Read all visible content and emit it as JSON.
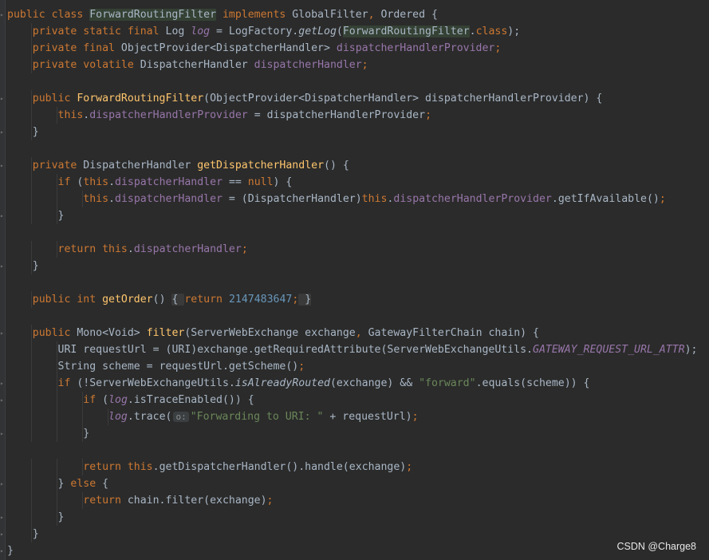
{
  "editor": {
    "lines": [
      [
        [
          "public class ",
          "k"
        ],
        [
          "ForwardRoutingFilter",
          "hl"
        ],
        [
          " implements ",
          "k"
        ],
        [
          "GlobalFilter",
          ""
        ],
        [
          ", ",
          "k"
        ],
        [
          "Ordered {",
          ""
        ]
      ],
      [
        [
          "    ",
          ""
        ],
        [
          "private static final ",
          "k"
        ],
        [
          "Log ",
          ""
        ],
        [
          "log",
          "fi"
        ],
        [
          " = LogFactory.",
          ""
        ],
        [
          "getLog",
          "it"
        ],
        [
          "(",
          ""
        ],
        [
          "ForwardRoutingFilter",
          "hl"
        ],
        [
          ".",
          ""
        ],
        [
          "class",
          "k"
        ],
        [
          ");",
          ""
        ]
      ],
      [
        [
          "    ",
          ""
        ],
        [
          "private final ",
          "k"
        ],
        [
          "ObjectProvider<DispatcherHandler> ",
          ""
        ],
        [
          "dispatcherHandlerProvider",
          "f"
        ],
        [
          ";",
          "k"
        ]
      ],
      [
        [
          "    ",
          ""
        ],
        [
          "private volatile ",
          "k"
        ],
        [
          "DispatcherHandler ",
          ""
        ],
        [
          "dispatcherHandler",
          "f"
        ],
        [
          ";",
          "k"
        ]
      ],
      [],
      [
        [
          "    ",
          ""
        ],
        [
          "public ",
          "k"
        ],
        [
          "ForwardRoutingFilter",
          "m"
        ],
        [
          "(ObjectProvider<DispatcherHandler> dispatcherHandlerProvider) {",
          ""
        ]
      ],
      [
        [
          "        ",
          ""
        ],
        [
          "this",
          "k"
        ],
        [
          ".",
          ""
        ],
        [
          "dispatcherHandlerProvider",
          "f"
        ],
        [
          " = dispatcherHandlerProvider",
          ""
        ],
        [
          ";",
          "k"
        ]
      ],
      [
        [
          "    }",
          ""
        ]
      ],
      [],
      [
        [
          "    ",
          ""
        ],
        [
          "private ",
          "k"
        ],
        [
          "DispatcherHandler ",
          ""
        ],
        [
          "getDispatcherHandler",
          "m"
        ],
        [
          "() {",
          ""
        ]
      ],
      [
        [
          "        ",
          ""
        ],
        [
          "if ",
          "k"
        ],
        [
          "(",
          ""
        ],
        [
          "this",
          "k"
        ],
        [
          ".",
          ""
        ],
        [
          "dispatcherHandler",
          "f"
        ],
        [
          " == ",
          ""
        ],
        [
          "null",
          "k"
        ],
        [
          ") {",
          ""
        ]
      ],
      [
        [
          "            ",
          ""
        ],
        [
          "this",
          "k"
        ],
        [
          ".",
          ""
        ],
        [
          "dispatcherHandler",
          "f"
        ],
        [
          " = (DispatcherHandler)",
          ""
        ],
        [
          "this",
          "k"
        ],
        [
          ".",
          ""
        ],
        [
          "dispatcherHandlerProvider",
          "f"
        ],
        [
          ".getIfAvailable()",
          ""
        ],
        [
          ";",
          "k"
        ]
      ],
      [
        [
          "        }",
          ""
        ]
      ],
      [],
      [
        [
          "        ",
          ""
        ],
        [
          "return this",
          "k"
        ],
        [
          ".",
          ""
        ],
        [
          "dispatcherHandler",
          "f"
        ],
        [
          ";",
          "k"
        ]
      ],
      [
        [
          "    }",
          ""
        ]
      ],
      [],
      [
        [
          "    ",
          ""
        ],
        [
          "public int ",
          "k"
        ],
        [
          "getOrder",
          "m"
        ],
        [
          "() ",
          ""
        ],
        [
          "{ ",
          "fb"
        ],
        [
          "return ",
          "k"
        ],
        [
          "2147483647",
          "n"
        ],
        [
          ";",
          "k"
        ],
        [
          " }",
          "fb"
        ]
      ],
      [],
      [
        [
          "    ",
          ""
        ],
        [
          "public ",
          "k"
        ],
        [
          "Mono<Void> ",
          ""
        ],
        [
          "filter",
          "m"
        ],
        [
          "(ServerWebExchange exchange",
          ""
        ],
        [
          ", ",
          "k"
        ],
        [
          "GatewayFilterChain chain) {",
          ""
        ]
      ],
      [
        [
          "        ",
          ""
        ],
        [
          "URI requestUrl = (URI)exchange.getRequiredAttribute(ServerWebExchangeUtils.",
          ""
        ],
        [
          "GATEWAY_REQUEST_URL_ATTR",
          "fi"
        ],
        [
          ");",
          ""
        ]
      ],
      [
        [
          "        ",
          ""
        ],
        [
          "String scheme = requestUrl.getScheme()",
          ""
        ],
        [
          ";",
          "k"
        ]
      ],
      [
        [
          "        ",
          ""
        ],
        [
          "if ",
          "k"
        ],
        [
          "(!ServerWebExchangeUtils.",
          ""
        ],
        [
          "isAlreadyRouted",
          "it"
        ],
        [
          "(exchange) && ",
          ""
        ],
        [
          "\"forward\"",
          "s"
        ],
        [
          ".equals(scheme)) {",
          ""
        ]
      ],
      [
        [
          "            ",
          ""
        ],
        [
          "if ",
          "k"
        ],
        [
          "(",
          ""
        ],
        [
          "log",
          "fi"
        ],
        [
          ".isTraceEnabled()) {",
          ""
        ]
      ],
      [
        [
          "                ",
          ""
        ],
        [
          "log",
          "fi"
        ],
        [
          ".trace(",
          ""
        ],
        [
          "o:",
          "hint"
        ],
        [
          "\"Forwarding to URI: \"",
          "s"
        ],
        [
          " + requestUrl)",
          ""
        ],
        [
          ";",
          "k"
        ]
      ],
      [
        [
          "            }",
          ""
        ]
      ],
      [],
      [
        [
          "            ",
          ""
        ],
        [
          "return this",
          "k"
        ],
        [
          ".getDispatcherHandler().handle(exchange)",
          ""
        ],
        [
          ";",
          "k"
        ]
      ],
      [
        [
          "        } ",
          ""
        ],
        [
          "else ",
          "k"
        ],
        [
          "{",
          ""
        ]
      ],
      [
        [
          "            ",
          ""
        ],
        [
          "return ",
          "k"
        ],
        [
          "chain.filter(exchange)",
          ""
        ],
        [
          ";",
          "k"
        ]
      ],
      [
        [
          "        }",
          ""
        ]
      ],
      [
        [
          "    }",
          ""
        ]
      ],
      [
        [
          "}",
          ""
        ]
      ]
    ]
  },
  "watermark": "CSDN @Charge8"
}
